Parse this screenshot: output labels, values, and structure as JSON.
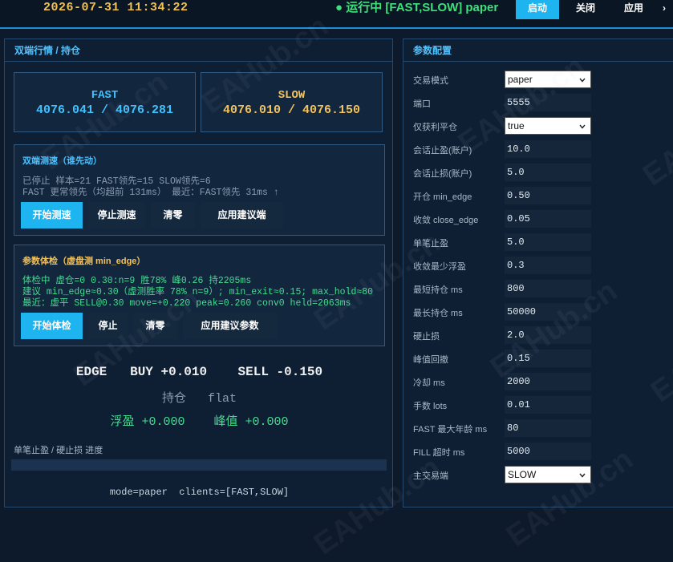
{
  "topbar": {
    "datetime": "2026-07-31   11:34:22",
    "status": "● 运行中 [FAST,SLOW] paper",
    "start_label": "启动",
    "close_label": "关闭",
    "apply_label": "应用",
    "extra_label": "→",
    "status_color": "#3ee07a",
    "accent": "#1db4f0"
  },
  "left": {
    "title": "双端行情 / 持仓",
    "fast": {
      "name": "FAST",
      "price": "4076.041 / 4076.281",
      "color": "#3fc2ff"
    },
    "slow": {
      "name": "SLOW",
      "price": "4076.010 / 4076.150",
      "color": "#f4c25a"
    },
    "speed": {
      "title": "双端测速（谁先动）",
      "line1": "已停止  样本=21  FAST领先=15  SLOW领先=6",
      "line2": "FAST 更常领先（均超前 131ms）  最近：FAST领先 31ms ↑",
      "buttons": [
        "开始测速",
        "停止测速",
        "清零",
        "应用建议端"
      ]
    },
    "check": {
      "title": "参数体检（虚盘测 min_edge）",
      "line1": "体检中 虚仓=0  0.30:n=9 胜78% 峰0.26 持2205ms",
      "line2": "建议 min_edge≈0.30（虚测胜率 78% n=9）; min_exit≈0.15; max_hold≈80",
      "line3": "最近：虚平 SELL@0.30 move=+0.220 peak=0.260 conv0 held=2063ms",
      "buttons": [
        "开始体检",
        "停止",
        "清零",
        "应用建议参数"
      ]
    },
    "edge": "EDGE   BUY +0.010    SELL -0.150",
    "hold": "持仓   flat",
    "pnl": "浮盈 +0.000    峰值 +0.000",
    "progress_label": "单笔止盈 / 硬止损 进度",
    "progress_fraction": 0,
    "footer": "mode=paper  clients=[FAST,SLOW]"
  },
  "config": {
    "title": "参数配置",
    "rows": [
      {
        "label": "交易模式",
        "value": "paper",
        "kind": "select"
      },
      {
        "label": "端口",
        "value": "5555",
        "kind": "input"
      },
      {
        "label": "仅获利平仓",
        "value": "true",
        "kind": "select"
      },
      {
        "label": "会话止盈(账户)",
        "value": "10.0",
        "kind": "input"
      },
      {
        "label": "会话止损(账户)",
        "value": "5.0",
        "kind": "input"
      },
      {
        "label": "开仓 min_edge",
        "value": "0.50",
        "kind": "input"
      },
      {
        "label": "收敛 close_edge",
        "value": "0.05",
        "kind": "input"
      },
      {
        "label": "单笔止盈",
        "value": "5.0",
        "kind": "input"
      },
      {
        "label": "收敛最少浮盈",
        "value": "0.3",
        "kind": "input"
      },
      {
        "label": "最短持仓 ms",
        "value": "800",
        "kind": "input"
      },
      {
        "label": "最长持仓 ms",
        "value": "50000",
        "kind": "input"
      },
      {
        "label": "硬止损",
        "value": "2.0",
        "kind": "input"
      },
      {
        "label": "峰值回撤",
        "value": "0.15",
        "kind": "input"
      },
      {
        "label": "冷却 ms",
        "value": "2000",
        "kind": "input"
      },
      {
        "label": "手数 lots",
        "value": "0.01",
        "kind": "input"
      },
      {
        "label": "FAST 最大年龄 ms",
        "value": "80",
        "kind": "input"
      },
      {
        "label": "FILL 超时 ms",
        "value": "5000",
        "kind": "input"
      },
      {
        "label": "主交易端",
        "value": "SLOW",
        "kind": "select"
      }
    ]
  },
  "watermark": "EAHub.cn"
}
